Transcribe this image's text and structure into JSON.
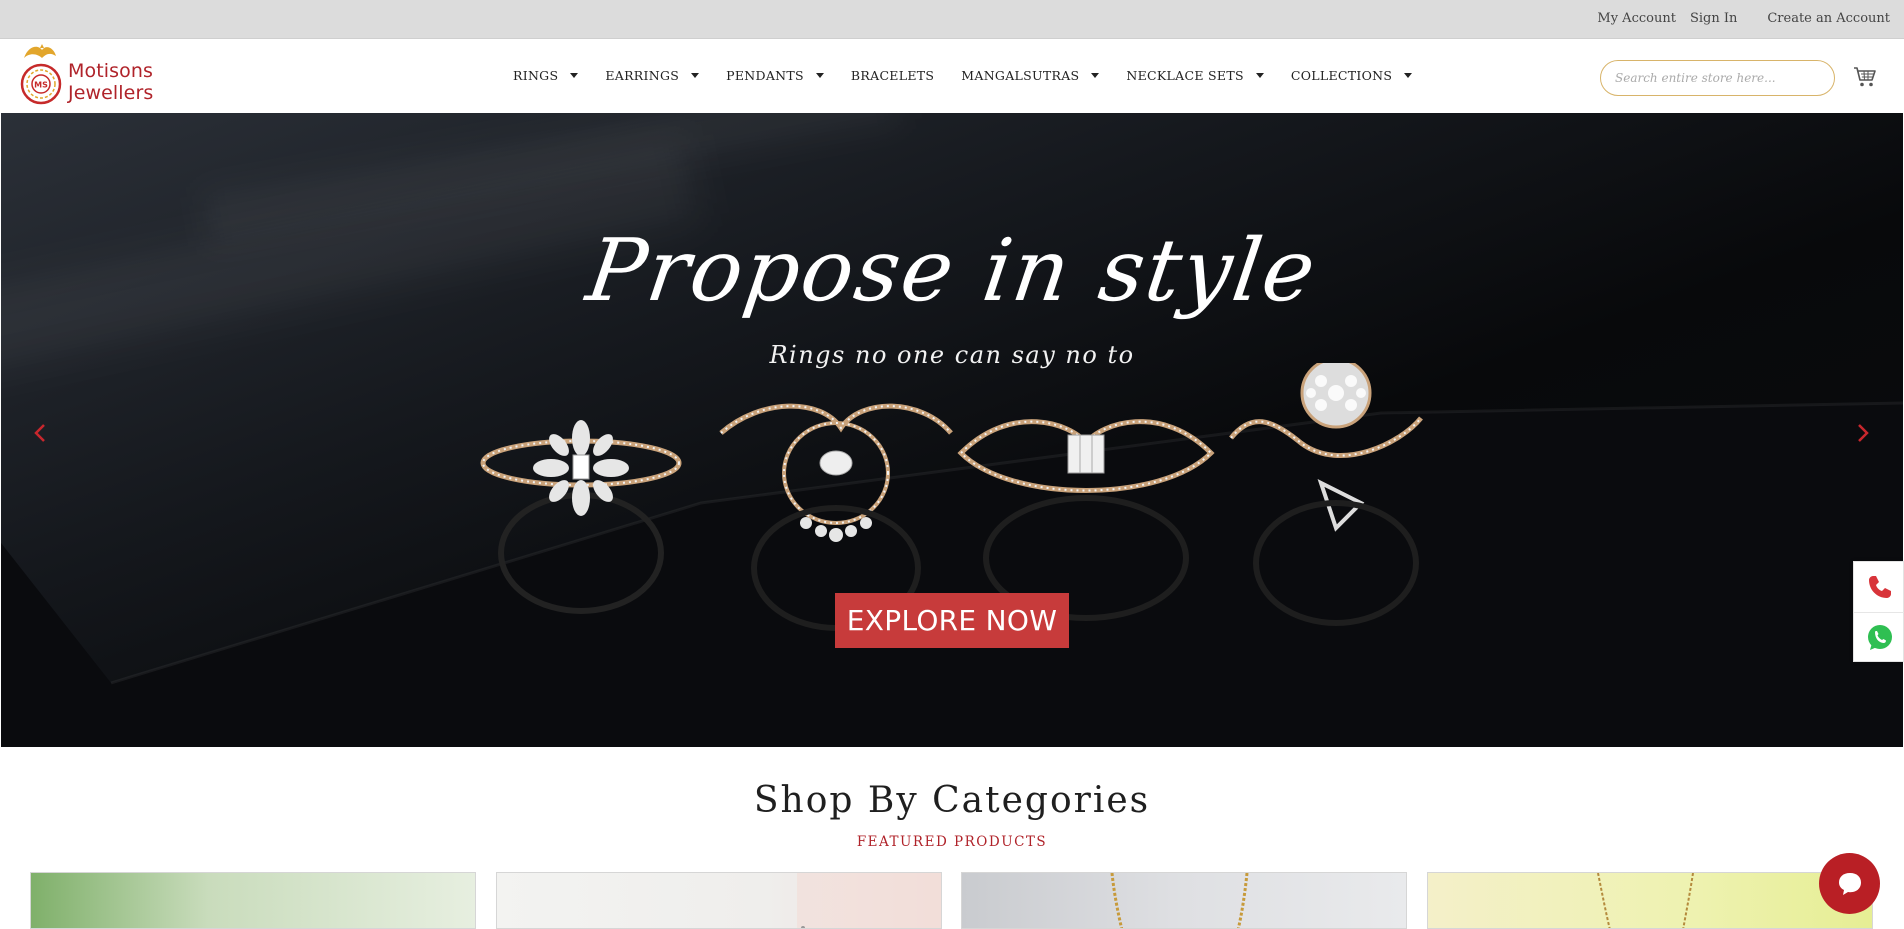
{
  "topbar": {
    "my_account": "My Account",
    "sign_in": "Sign In",
    "create_account": "Create an Account"
  },
  "brand": {
    "name": "Motisons Jewellers",
    "monogram": "MS",
    "color": "#b0232a"
  },
  "nav": {
    "items": [
      {
        "label": "RINGS",
        "dropdown": true
      },
      {
        "label": "EARRINGS",
        "dropdown": true
      },
      {
        "label": "PENDANTS",
        "dropdown": true
      },
      {
        "label": "BRACELETS",
        "dropdown": false
      },
      {
        "label": "MANGALSUTRAS",
        "dropdown": true
      },
      {
        "label": "NECKLACE SETS",
        "dropdown": true
      },
      {
        "label": "COLLECTIONS",
        "dropdown": true
      }
    ]
  },
  "search": {
    "placeholder": "Search entire store here..."
  },
  "icons": {
    "cart": "cart-icon",
    "prev": "chevron-left-icon",
    "next": "chevron-right-icon",
    "phone": "phone-icon",
    "whatsapp": "whatsapp-icon",
    "chat": "chat-icon"
  },
  "hero": {
    "title": "Propose in style",
    "subtitle": "Rings no one can say no to",
    "cta": "EXPLORE NOW",
    "cta_color": "#c73b3b"
  },
  "section": {
    "title": "Shop By Categories",
    "subtitle": "FEATURED PRODUCTS"
  }
}
